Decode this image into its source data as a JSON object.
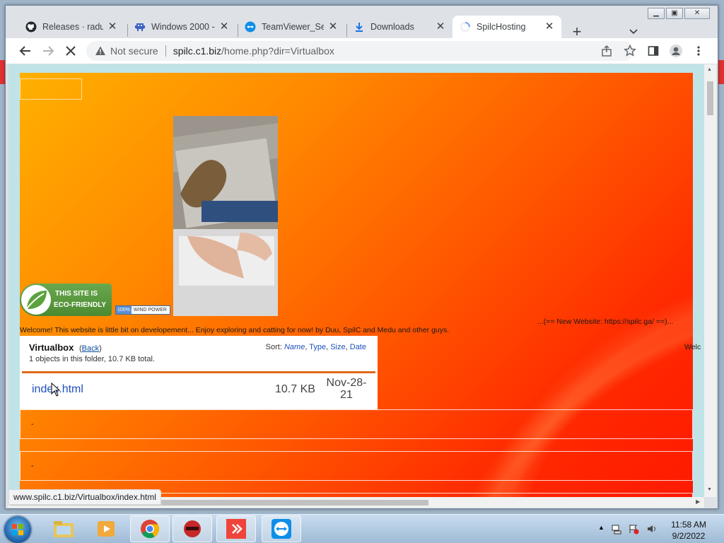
{
  "browser": {
    "tabs": [
      {
        "label": "Releases · radub",
        "icon": "github-icon",
        "active": false
      },
      {
        "label": "Windows 2000 -",
        "icon": "space-invader-icon",
        "active": false
      },
      {
        "label": "TeamViewer_Set",
        "icon": "teamviewer-icon",
        "active": false
      },
      {
        "label": "Downloads",
        "icon": "download-icon",
        "active": false
      },
      {
        "label": "SpilcHosting",
        "icon": "loading-spinner-icon",
        "active": true
      }
    ],
    "new_tab": "+",
    "security_label": "Not secure",
    "url_host": "spilc.c1.biz",
    "url_path": "/home.php?dir=Virtualbox",
    "status_url": "www.spilc.c1.biz/Virtualbox/index.html"
  },
  "page": {
    "eco_badge": {
      "line1": "THIS SITE IS",
      "line2": "ECO-FRIENDLY"
    },
    "wind_badge": {
      "percent": "100%",
      "label": "WIND POWER"
    },
    "welcome_text": "Welcome! This website is little bit on developement... Enjoy exploring and catting for now! by Duu, SpilC and Medu and other guys.",
    "new_website_text": "...(== New Website: https://spilc.ga/ ==)...",
    "marquee_fragment": "Welc",
    "folder": {
      "name": "Virtualbox",
      "back_open": "(",
      "back_label": "Back",
      "back_close": ")",
      "summary": "1 objects in this folder, 10.7 KB total.",
      "sort_label": "Sort:",
      "sort_options": [
        "Name",
        "Type",
        "Size",
        "Date"
      ],
      "sort_sep": ",",
      "files": [
        {
          "name": "index.html",
          "size": "10.7 KB",
          "date_line1": "Nov-28-",
          "date_line2": "21"
        }
      ]
    },
    "rows": [
      "-",
      "-"
    ]
  },
  "taskbar": {
    "apps": [
      "explorer-icon",
      "media-player-icon",
      "chrome-icon",
      "red-helmet-app-icon",
      "anydesk-icon",
      "teamviewer-icon"
    ],
    "time": "11:58 AM",
    "date": "9/2/2022"
  },
  "colors": {
    "accent_orange": "#e06a1a",
    "link_blue": "#1f4fbf",
    "page_red": "#ff2a00"
  }
}
